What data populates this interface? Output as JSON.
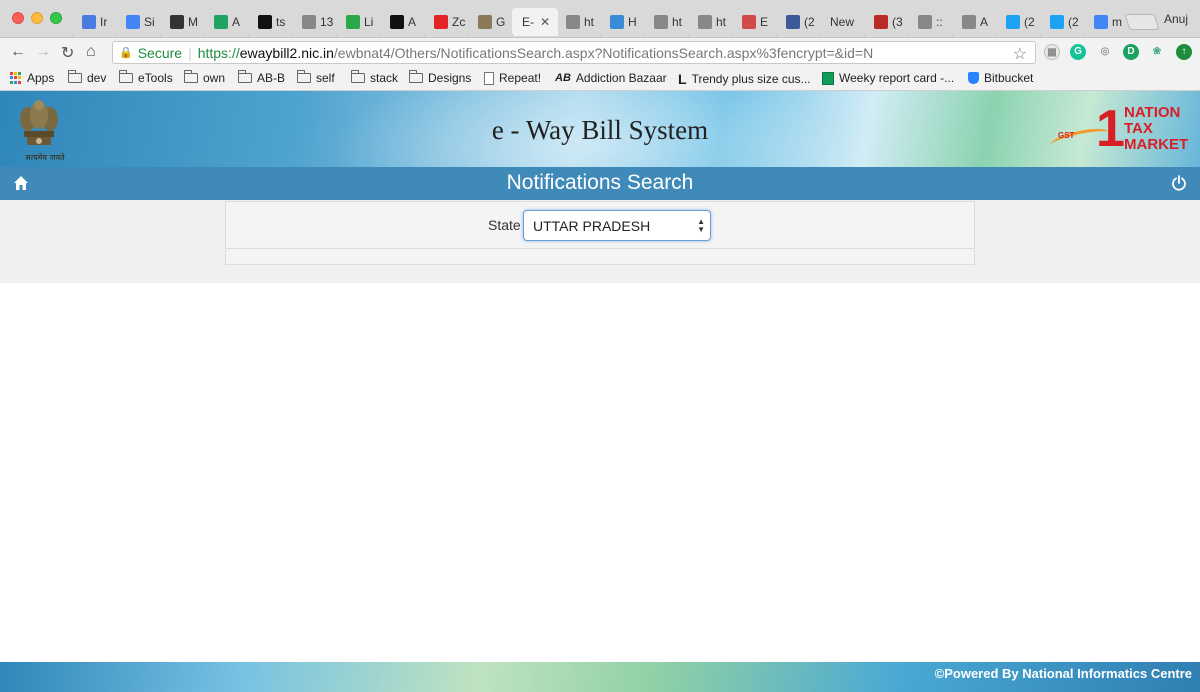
{
  "browser": {
    "profile_name": "Anuj",
    "tabs": [
      {
        "label": "Ir",
        "icon": "inbox-icon",
        "color": "#4a7be0"
      },
      {
        "label": "Si",
        "icon": "google-icon",
        "color": "#4285f4"
      },
      {
        "label": "M",
        "icon": "clock-icon",
        "color": "#333333"
      },
      {
        "label": "A",
        "icon": "drive-icon",
        "color": "#1fa463"
      },
      {
        "label": "ts",
        "icon": "addiction-bazaar-icon",
        "color": "#111111"
      },
      {
        "label": "13",
        "icon": "page-icon",
        "color": "#888888"
      },
      {
        "label": "Li",
        "icon": "cube-icon",
        "color": "#2aa84a"
      },
      {
        "label": "A",
        "icon": "addiction-bazaar-icon",
        "color": "#111111"
      },
      {
        "label": "Zc",
        "icon": "zoho-icon",
        "color": "#e42527"
      },
      {
        "label": "G",
        "icon": "emblem-icon",
        "color": "#8a7a5a"
      },
      {
        "label": "E-",
        "icon": "",
        "color": "#333333",
        "active": true
      },
      {
        "label": "ht",
        "icon": "page-icon",
        "color": "#888888"
      },
      {
        "label": "H",
        "icon": "globe-icon",
        "color": "#3b8ad8"
      },
      {
        "label": "ht",
        "icon": "page-icon",
        "color": "#888888"
      },
      {
        "label": "ht",
        "icon": "page-icon",
        "color": "#888888"
      },
      {
        "label": "E",
        "icon": "dots-icon",
        "color": "#d24b4b"
      },
      {
        "label": "(2",
        "icon": "facebook-icon",
        "color": "#3b5998"
      },
      {
        "label": "New",
        "icon": "",
        "color": "#333333"
      },
      {
        "label": "(3",
        "icon": "quora-icon",
        "color": "#b92b27"
      },
      {
        "label": "::",
        "icon": "page-icon",
        "color": "#888888"
      },
      {
        "label": "A",
        "icon": "page-icon",
        "color": "#888888"
      },
      {
        "label": "(2",
        "icon": "twitter-icon",
        "color": "#1da1f2"
      },
      {
        "label": "(2",
        "icon": "twitter-icon",
        "color": "#1da1f2"
      },
      {
        "label": "m",
        "icon": "google-icon",
        "color": "#4285f4"
      }
    ],
    "omnibox": {
      "secure_label": "Secure",
      "url_scheme": "https://",
      "url_host": "ewaybill2.nic.in",
      "url_path": "/ewbnat4/Others/NotificationsSearch.aspx?NotificationsSearch.aspx%3fencrypt=&id=N"
    },
    "bookmarks": [
      {
        "label": "Apps",
        "icon": "apps-icon"
      },
      {
        "label": "dev",
        "icon": "folder-icon"
      },
      {
        "label": "eTools",
        "icon": "folder-icon"
      },
      {
        "label": "own",
        "icon": "folder-icon"
      },
      {
        "label": "AB-B",
        "icon": "folder-icon"
      },
      {
        "label": "self",
        "icon": "folder-icon"
      },
      {
        "label": "stack",
        "icon": "folder-icon"
      },
      {
        "label": "Designs",
        "icon": "folder-icon"
      },
      {
        "label": "Repeat!",
        "icon": "page-icon"
      },
      {
        "label": "Addiction Bazaar",
        "icon": "addiction-bazaar-icon"
      },
      {
        "label": "Trendy plus size cus...",
        "icon": "l-logo-icon"
      },
      {
        "label": "Weeky report card -...",
        "icon": "sheets-icon"
      },
      {
        "label": "Bitbucket",
        "icon": "bitbucket-icon"
      }
    ]
  },
  "site": {
    "header_title": "e - Way Bill System",
    "emblem_caption": "सत्यमेव जयते",
    "gst_logo": {
      "line1": "NATION",
      "line2": "TAX",
      "line3": "MARKET",
      "numeral": "1",
      "badge": "GST"
    },
    "page_title": "Notifications Search",
    "form": {
      "state_label": "State",
      "state_selected": "UTTAR PRADESH"
    },
    "footer_text": "©Powered By National Informatics Centre"
  },
  "colors": {
    "titlebar": "#3f8ab9",
    "content_bg": "#f0f0f0",
    "accent_red": "#d91f26"
  }
}
